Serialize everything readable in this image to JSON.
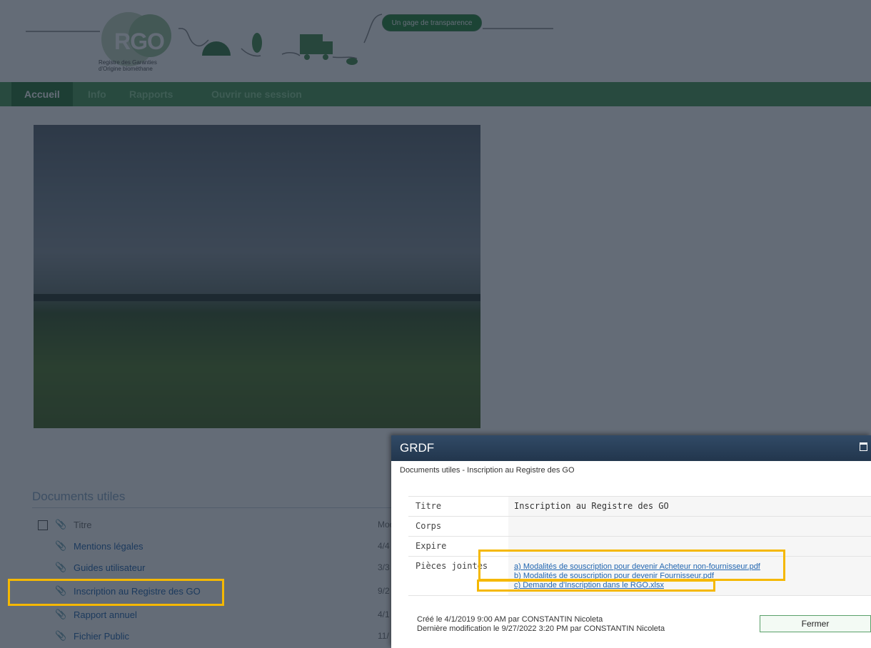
{
  "header": {
    "logo_text": "RGO",
    "logo_subtitle": "Registre des Garanties d'Origine biométhane",
    "tagline": "Un gage de transparence"
  },
  "nav": {
    "items": [
      {
        "label": "Accueil",
        "active": true
      },
      {
        "label": "Info"
      },
      {
        "label": "Rapports"
      },
      {
        "label": "Ouvrir une session"
      }
    ]
  },
  "documents": {
    "section_title": "Documents utiles",
    "columns": {
      "title": "Titre",
      "modified": "Moc"
    },
    "rows": [
      {
        "title": "Mentions légales",
        "date": "4/4"
      },
      {
        "title": "Guides utilisateur",
        "date": "3/3"
      },
      {
        "title": "Inscription au Registre des GO",
        "date": "9/2"
      },
      {
        "title": "Rapport annuel",
        "date": "4/1"
      },
      {
        "title": "Fichier Public",
        "date": "11/"
      }
    ]
  },
  "dialog": {
    "title": "GRDF",
    "breadcrumb": "Documents utiles - Inscription au Registre des GO",
    "fields": {
      "titre_label": "Titre",
      "titre_value": "Inscription au Registre des GO",
      "corps_label": "Corps",
      "expire_label": "Expire",
      "pieces_label": "Pièces jointes"
    },
    "attachments": [
      "a) Modalités de souscription pour devenir Acheteur non-fournisseur.pdf",
      "b) Modalités de souscription pour devenir Fournisseur.pdf",
      "c) Demande d'Inscription dans le RGO.xlsx"
    ],
    "created": "Créé le 4/1/2019 9:00 AM par CONSTANTIN Nicoleta",
    "modified": "Dernière modification le 9/27/2022 3:20 PM par CONSTANTIN Nicoleta",
    "close_label": "Fermer"
  },
  "colors": {
    "nav_green": "#4f9c5b",
    "highlight": "#f5b800",
    "dialog_header": "#22364d",
    "link": "#2266b0"
  }
}
